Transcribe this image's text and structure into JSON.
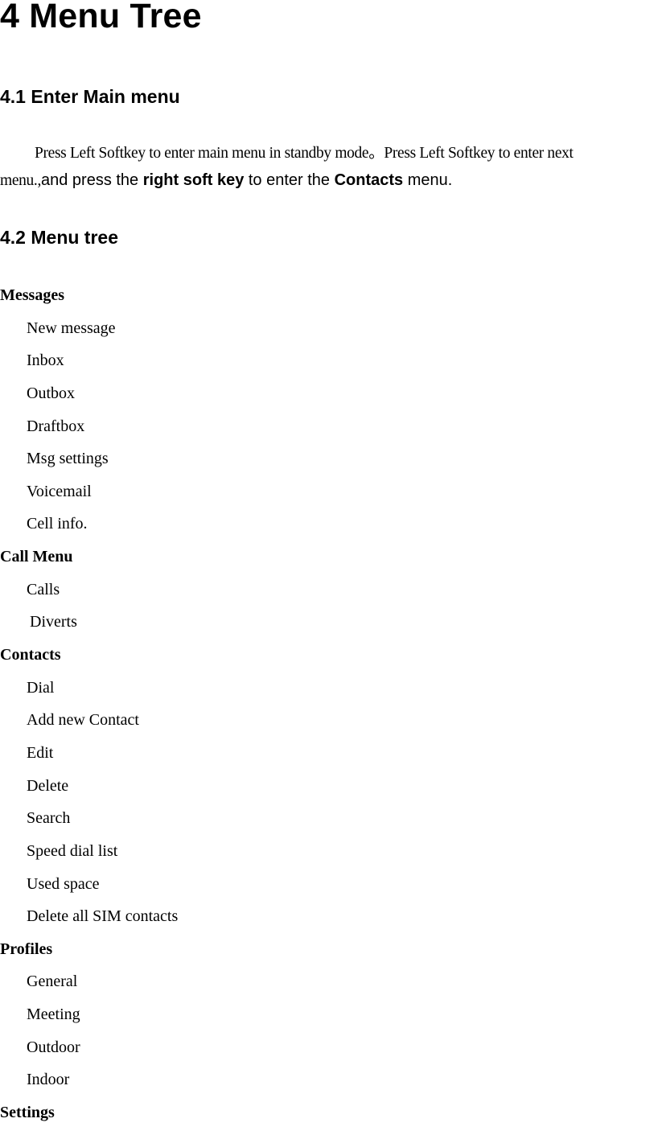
{
  "document": {
    "chapter_title": "4 Menu Tree",
    "section_1": {
      "title": "4.1 Enter Main menu",
      "line1": "Press Left Softkey to enter main menu in standby mode。Press Left Softkey to enter next",
      "line2_serif": "menu.,",
      "line2_part1": "and press the ",
      "line2_bold1": "right soft key",
      "line2_part2": " to enter the ",
      "line2_bold2": "Contacts",
      "line2_part3": " menu."
    },
    "section_2": {
      "title": "4.2 Menu tree"
    },
    "menu_tree": [
      {
        "label": "Messages",
        "items": [
          "New message",
          "Inbox",
          "Outbox",
          "Draftbox",
          "Msg settings",
          "Voicemail",
          "Cell info."
        ]
      },
      {
        "label": "Call Menu",
        "items": [
          "Calls",
          "Diverts"
        ]
      },
      {
        "label": "Contacts",
        "items": [
          "Dial",
          "Add new Contact",
          "Edit",
          "Delete",
          "Search",
          "Speed dial list",
          "Used space",
          "Delete all SIM contacts"
        ]
      },
      {
        "label": "Profiles",
        "items": [
          "General",
          "Meeting",
          "Outdoor",
          "Indoor"
        ]
      },
      {
        "label": "Settings",
        "items": []
      }
    ]
  }
}
